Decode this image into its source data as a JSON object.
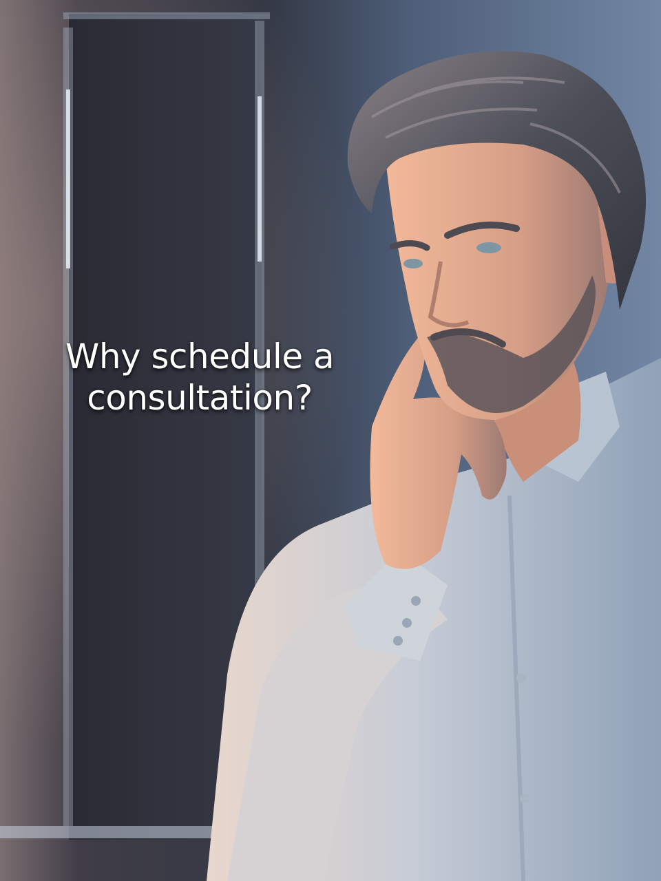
{
  "headline": {
    "line1": "Why schedule a",
    "line2": "consultation?"
  },
  "colors": {
    "background_dark": "#2a2f3a",
    "wall_blue": "#5a6d89",
    "shirt": "#c9d2dc",
    "skin": "#d9a58c",
    "hair": "#4a4c55",
    "text": "#ffffff"
  }
}
